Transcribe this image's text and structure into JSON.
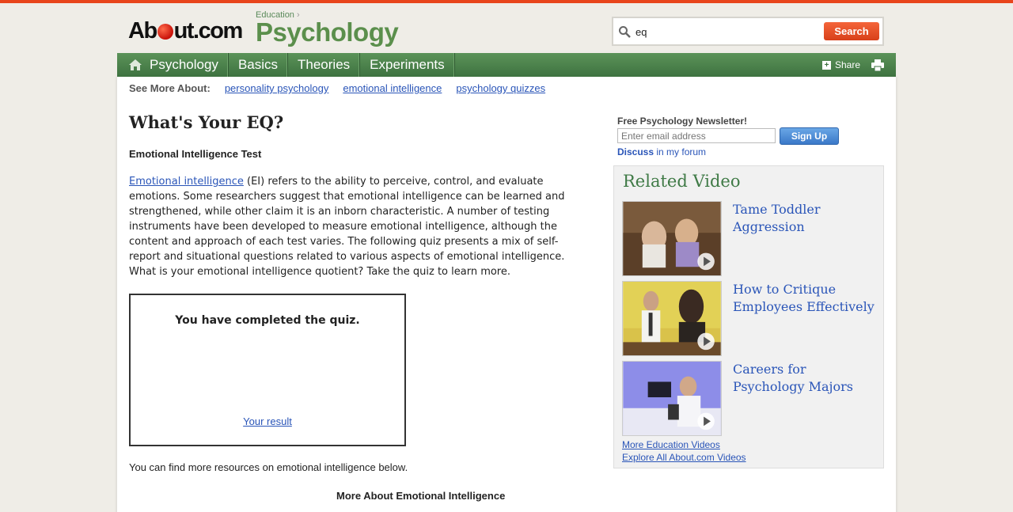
{
  "header": {
    "logo_text_a": "Ab",
    "logo_text_b": "ut.com",
    "breadcrumb": "Education",
    "site_title": "Psychology",
    "search_value": "eq",
    "search_button": "Search"
  },
  "nav": {
    "items": [
      "Psychology",
      "Basics",
      "Theories",
      "Experiments"
    ],
    "share": "Share"
  },
  "see_more": {
    "label": "See More About:",
    "links": [
      "personality psychology",
      "emotional intelligence",
      "psychology quizzes"
    ]
  },
  "article": {
    "title": "What's Your EQ?",
    "subtitle": "Emotional Intelligence Test",
    "body_link": "Emotional intelligence",
    "body_text": " (EI) refers to the ability to perceive, control, and evaluate emotions. Some researchers suggest that emotional intelligence can be learned and strengthened, while other claim it is an inborn characteristic. A number of testing instruments have been developed to measure emotional intelligence, although the content and approach of each test varies. The following quiz presents a mix of self-report and situational questions related to various aspects of emotional intelligence. What is your emotional intelligence quotient? Take the quiz to learn more.",
    "quiz_message": "You have completed the quiz.",
    "quiz_result_link": "Your result",
    "more_resources": "You can find more resources on emotional intelligence below.",
    "more_about": "More About Emotional Intelligence"
  },
  "sidebar": {
    "newsletter_title": "Free Psychology Newsletter!",
    "newsletter_placeholder": "Enter email address",
    "signup_button": "Sign Up",
    "discuss_bold": "Discuss",
    "discuss_rest": " in my forum",
    "related_title": "Related Video",
    "videos": [
      {
        "title": "Tame Toddler Aggression"
      },
      {
        "title": "How to Critique Employees Effectively"
      },
      {
        "title": "Careers for Psychology Majors"
      }
    ],
    "more_videos": "More Education Videos",
    "explore_videos": "Explore All About.com Videos"
  },
  "colors": {
    "accent_orange": "#e8451c",
    "nav_green": "#4a8049",
    "link_blue": "#2a55b8"
  }
}
